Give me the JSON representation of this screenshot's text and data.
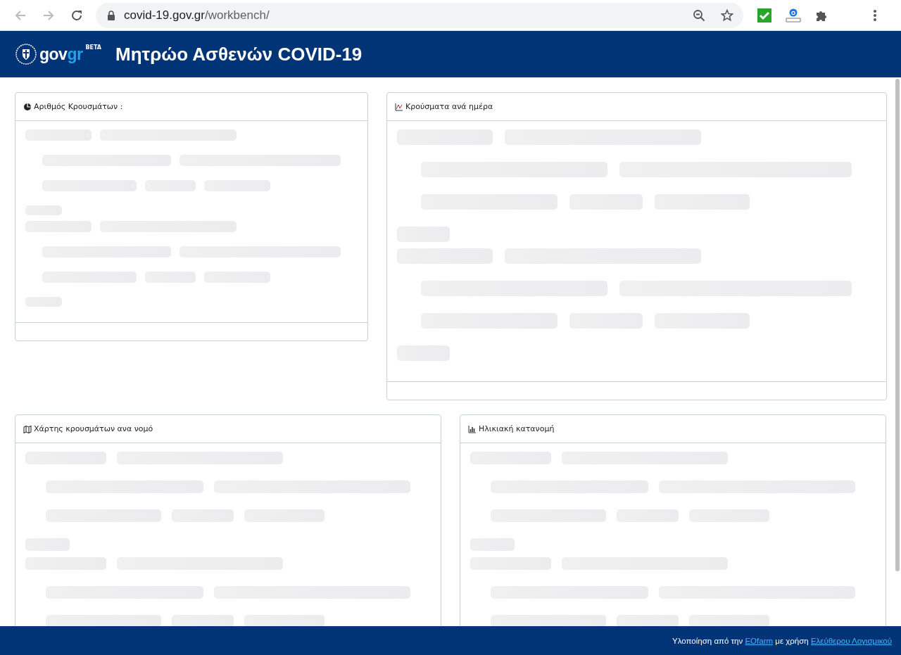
{
  "browser": {
    "url_host": "covid-19.gov.gr",
    "url_path": "/workbench/"
  },
  "header": {
    "logo": {
      "gov": "gov",
      "gr": "gr",
      "badge": "BETA"
    },
    "title": "Μητρώο Ασθενών COVID-19"
  },
  "cards": [
    {
      "kind": "pie",
      "title": "Αριθμός Κρουσμάτων :"
    },
    {
      "kind": "line",
      "title": "Κρούσματα ανά ημέρα"
    },
    {
      "kind": "map",
      "title": "Χάρτης κρουσμάτων ανα νομό"
    },
    {
      "kind": "bar",
      "title": "Ηλικιακή κατανομή"
    }
  ],
  "footer": {
    "text_before": "Υλοποίηση από την",
    "link1": "EOfarm",
    "text_middle": "με χρήση",
    "link2": "Ελεύθερου Λογισμικού"
  }
}
